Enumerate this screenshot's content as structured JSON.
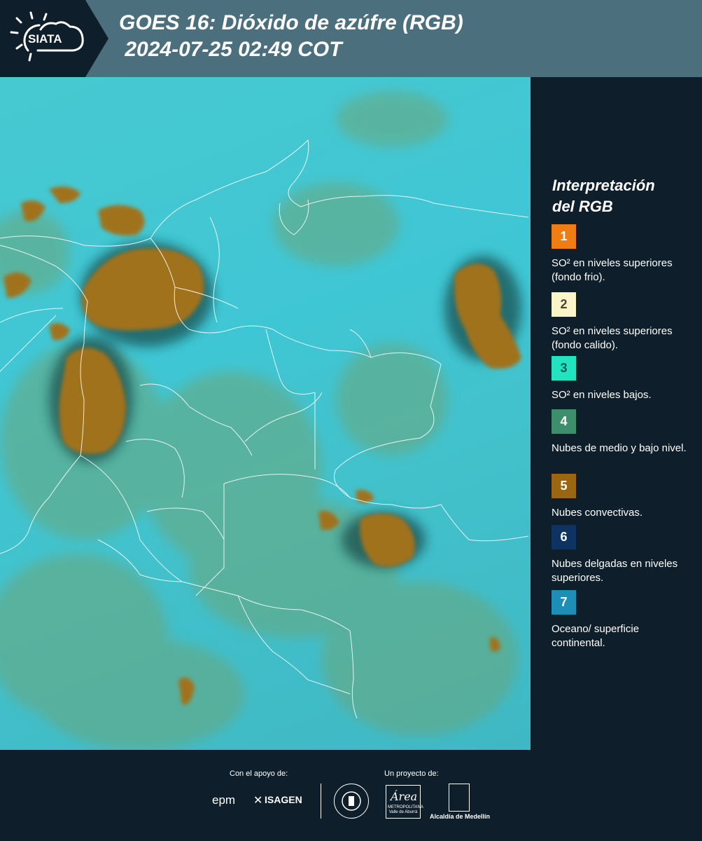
{
  "header": {
    "logo_text": "SIATA",
    "title": "GOES 16: Dióxido de azúfre (RGB)\n 2024-07-25 02:49 COT"
  },
  "legend": {
    "title": "Interpretación\ndel RGB",
    "items": [
      {
        "number": "1",
        "color": "#f07d12",
        "text_color": "#ffffff",
        "description": "SO² en niveles superiores (fondo frio)."
      },
      {
        "number": "2",
        "color": "#fbf4c6",
        "text_color": "#444444",
        "description": "SO² en niveles superiores (fondo calido)."
      },
      {
        "number": "3",
        "color": "#22e3c0",
        "text_color": "#0e5b55",
        "description": "SO² en niveles bajos."
      },
      {
        "number": "4",
        "color": "#3c8f6a",
        "text_color": "#ffffff",
        "description": "Nubes de medio y bajo nivel."
      },
      {
        "number": "5",
        "color": "#9a660f",
        "text_color": "#ffffff",
        "description": "Nubes convectivas."
      },
      {
        "number": "6",
        "color": "#0d3362",
        "text_color": "#ffffff",
        "description": "Nubes delgadas en niveles superiores."
      },
      {
        "number": "7",
        "color": "#1d8eb6",
        "text_color": "#ffffff",
        "description": "Oceano/ superficie continental."
      }
    ]
  },
  "footer": {
    "support_label": "Con el apoyo de:",
    "project_label": "Un proyecto de:",
    "sponsor_1": "epm",
    "sponsor_2": "ISAGEN",
    "partner_area": "Área",
    "partner_area_sub": "METROPOLITANA\nValle de Aburrá",
    "partner_alcaldia": "Alcaldía de Medellín"
  }
}
